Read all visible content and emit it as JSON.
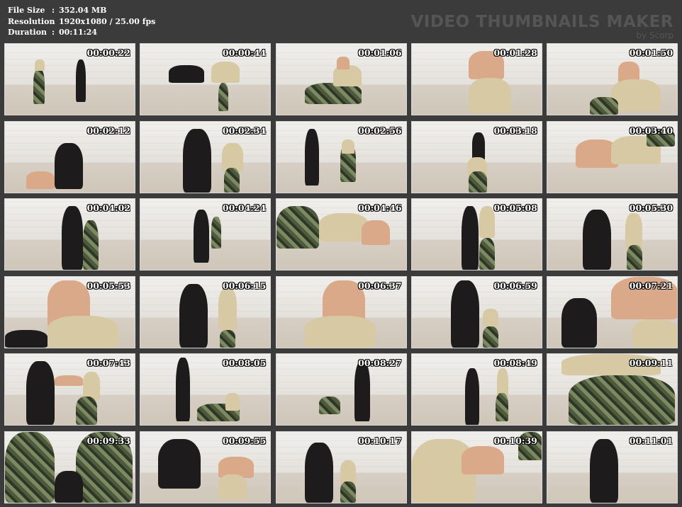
{
  "header": {
    "file_size_label": "File Size",
    "file_size_value": "352.04 MB",
    "resolution_label": "Resolution",
    "resolution_value": "1920x1080 / 25.00 fps",
    "duration_label": "Duration",
    "duration_value": "00:11:24",
    "separator": ":"
  },
  "brand": {
    "title": "VIDEO THUMBNAILS MAKER",
    "subtitle": "by Scorp"
  },
  "thumbnails": [
    {
      "time": "00:00:22"
    },
    {
      "time": "00:00:44"
    },
    {
      "time": "00:01:06"
    },
    {
      "time": "00:01:28"
    },
    {
      "time": "00:01:50"
    },
    {
      "time": "00:02:12"
    },
    {
      "time": "00:02:34"
    },
    {
      "time": "00:02:56"
    },
    {
      "time": "00:03:18"
    },
    {
      "time": "00:03:40"
    },
    {
      "time": "00:04:02"
    },
    {
      "time": "00:04:24"
    },
    {
      "time": "00:04:46"
    },
    {
      "time": "00:05:08"
    },
    {
      "time": "00:05:30"
    },
    {
      "time": "00:05:53"
    },
    {
      "time": "00:06:15"
    },
    {
      "time": "00:06:37"
    },
    {
      "time": "00:06:59"
    },
    {
      "time": "00:07:21"
    },
    {
      "time": "00:07:43"
    },
    {
      "time": "00:08:05"
    },
    {
      "time": "00:08:27"
    },
    {
      "time": "00:08:49"
    },
    {
      "time": "00:09:11"
    },
    {
      "time": "00:09:33"
    },
    {
      "time": "00:09:55"
    },
    {
      "time": "00:10:17"
    },
    {
      "time": "00:10:39"
    },
    {
      "time": "00:11:01"
    }
  ]
}
